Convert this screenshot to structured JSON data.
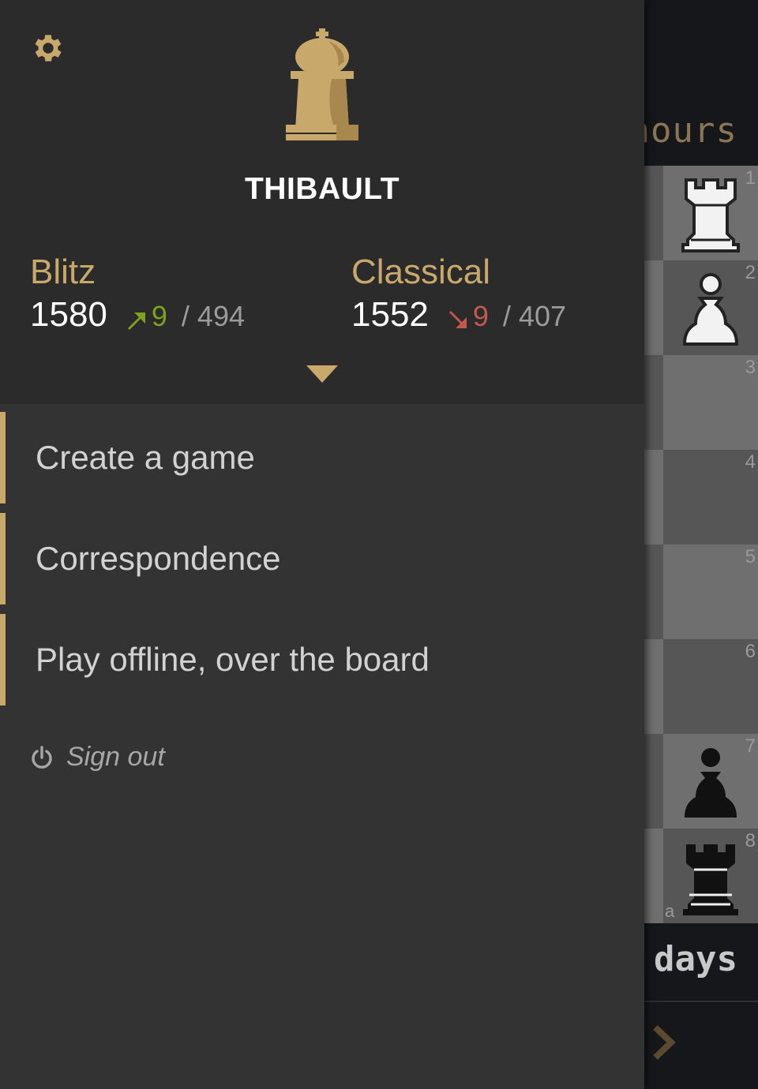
{
  "background": {
    "top_text": "hours",
    "bottom_text": "days",
    "board": {
      "rank_labels": [
        "1",
        "2",
        "3",
        "4",
        "5",
        "6",
        "7",
        "8"
      ],
      "file_label": "a",
      "pieces_visible": [
        "white-rook",
        "white-pawn",
        "black-pawn",
        "black-rook"
      ]
    }
  },
  "menu": {
    "settings_icon": "gear-icon",
    "avatar_icon": "chess-king-icon",
    "username": "THIBAULT",
    "perfs": [
      {
        "name": "Blitz",
        "rating": "1580",
        "trend": "up",
        "diff": "9",
        "games": "/ 494"
      },
      {
        "name": "Classical",
        "rating": "1552",
        "trend": "down",
        "diff": "9",
        "games": "/ 407"
      }
    ],
    "expand_icon": "caret-down-icon",
    "items": [
      {
        "label": "Create a game"
      },
      {
        "label": "Correspondence"
      },
      {
        "label": "Play offline, over the board"
      }
    ],
    "signout": {
      "icon": "power-icon",
      "label": "Sign out"
    }
  },
  "colors": {
    "accent": "#c9a96b",
    "menu_bg": "#333333",
    "header_bg": "#2b2b2b",
    "up": "#7ea21b",
    "down": "#c45a4e"
  }
}
